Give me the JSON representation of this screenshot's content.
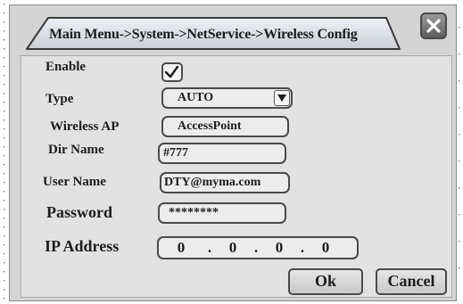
{
  "dialog": {
    "breadcrumb": "Main Menu->System->NetService->Wireless Config",
    "close_icon": "close-x-icon"
  },
  "form": {
    "enable": {
      "label": "Enable",
      "checked": true,
      "check_icon": "checkmark-icon"
    },
    "type": {
      "label": "Type",
      "value": "AUTO",
      "arrow_icon": "dropdown-triangle-icon"
    },
    "wireless_ap": {
      "label": "Wireless AP",
      "value": "AccessPoint"
    },
    "dir_name": {
      "label": "Dir Name",
      "value": "#777"
    },
    "user_name": {
      "label": "User Name",
      "value": "DTY@myma.com"
    },
    "password": {
      "label": "Password",
      "value": "********"
    },
    "ip_address": {
      "label": "IP Address",
      "octets": [
        "0",
        "0",
        "0",
        "0"
      ],
      "separator": "."
    }
  },
  "buttons": {
    "ok": "Ok",
    "cancel": "Cancel"
  },
  "colors": {
    "dialog_bg": "#d4d4d4",
    "content_bg": "#e2e2e2",
    "field_border": "#4a4a4a",
    "title_tab_bg": "#d7dce2"
  }
}
